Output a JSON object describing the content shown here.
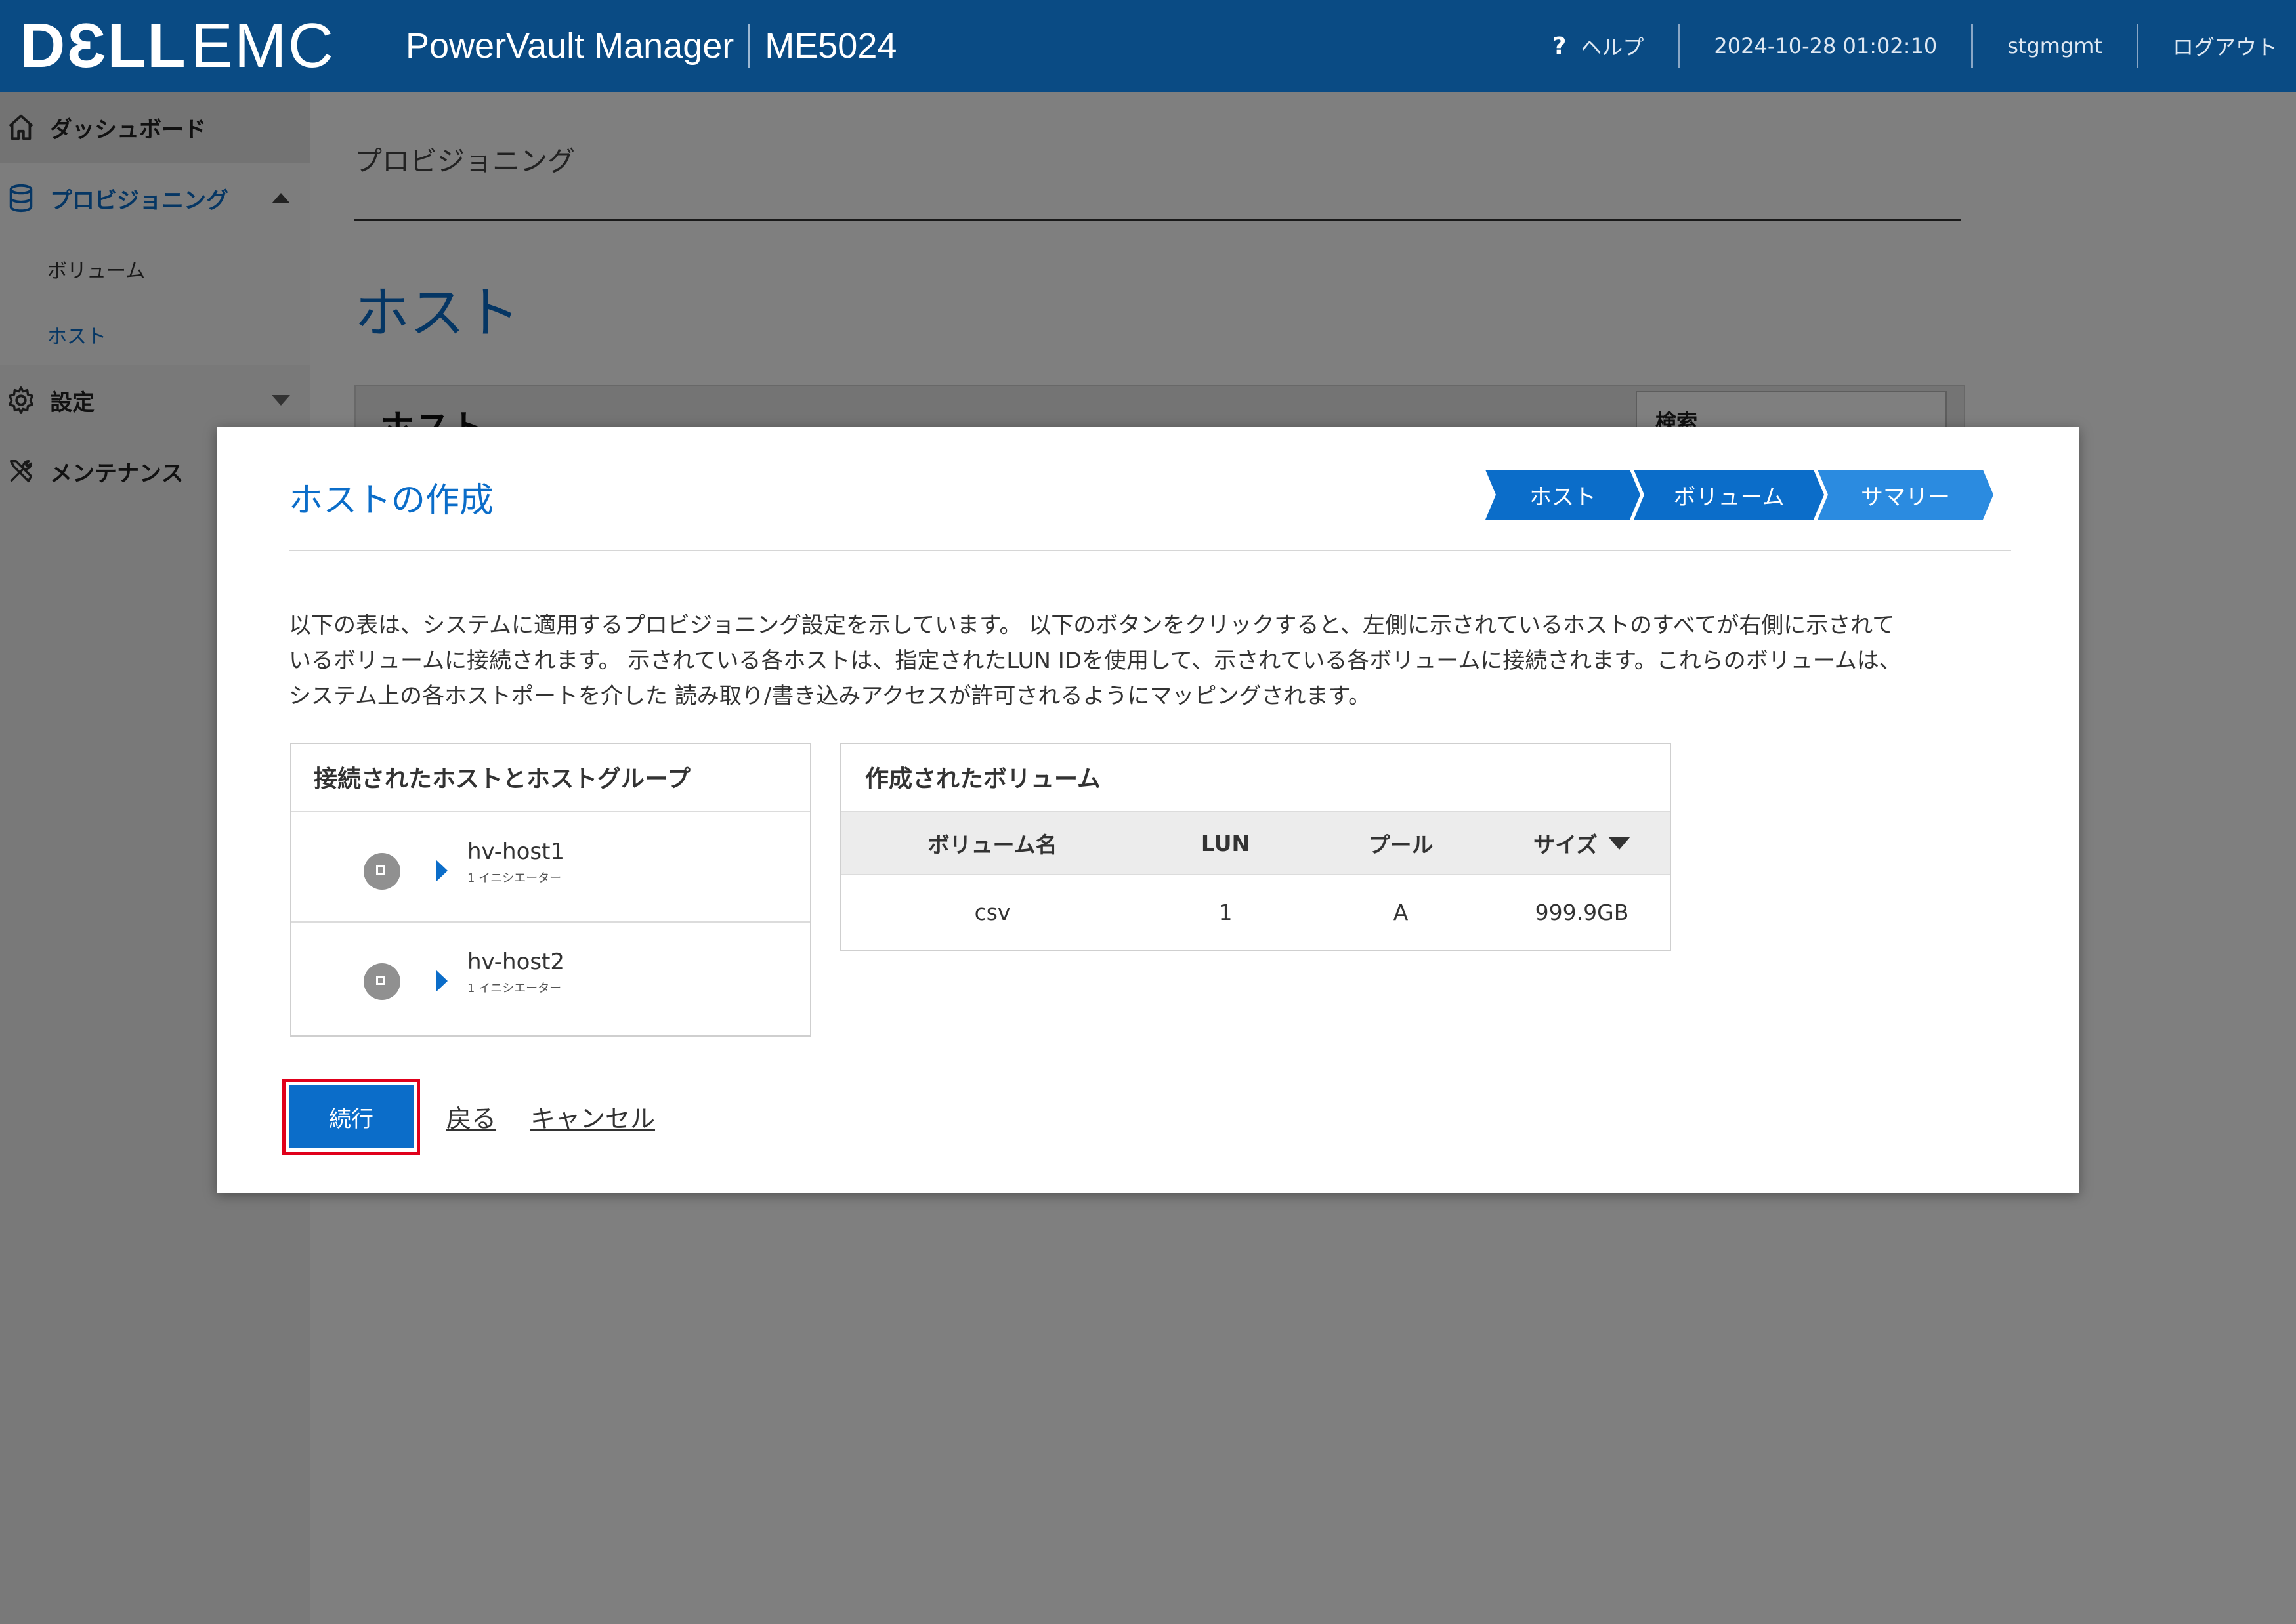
{
  "header": {
    "logo_dell": "DƐLL",
    "logo_emc": "EMC",
    "product": "PowerVault Manager",
    "model": "ME5024",
    "help": "ヘルプ",
    "datetime": "2024-10-28 01:02:10",
    "user": "stgmgmt",
    "logout": "ログアウト"
  },
  "sidebar": {
    "dashboard": "ダッシュボード",
    "provisioning": "プロビジョニング",
    "volumes": "ボリューム",
    "hosts": "ホスト",
    "settings": "設定",
    "maintenance": "メンテナンス"
  },
  "main": {
    "breadcrumb": "プロビジョニング",
    "title": "ホスト",
    "panel_title": "ホスト",
    "search_label": "検索"
  },
  "modal": {
    "title": "ホストの作成",
    "steps": [
      "ホスト",
      "ボリューム",
      "サマリー"
    ],
    "description_lines": [
      "以下の表は、システムに適用するプロビジョニング設定を示しています。 以下のボタンをクリックすると、左側に示されているホストのすべてが右側に示されて",
      "いるボリュームに接続されます。 示されている各ホストは、指定されたLUN IDを使用して、示されている各ボリュームに接続されます。これらのボリュームは、",
      "システム上の各ホストポートを介した 読み取り/書き込みアクセスが許可されるようにマッピングされます。"
    ],
    "hosts_panel": {
      "header": "接続されたホストとホストグループ",
      "hosts": [
        {
          "name": "hv-host1",
          "sub": "1 イニシエーター"
        },
        {
          "name": "hv-host2",
          "sub": "1 イニシエーター"
        }
      ]
    },
    "volumes_panel": {
      "header": "作成されたボリューム",
      "columns": [
        "ボリューム名",
        "LUN",
        "プール",
        "サイズ"
      ],
      "rows": [
        {
          "name": "csv",
          "lun": "1",
          "pool": "A",
          "size": "999.9GB"
        }
      ]
    },
    "actions": {
      "continue": "続行",
      "back": "戻る",
      "cancel": "キャンセル"
    }
  },
  "colors": {
    "header_bg": "#0a4b84",
    "accent": "#0b6dc9",
    "highlight": "#e0001b"
  }
}
